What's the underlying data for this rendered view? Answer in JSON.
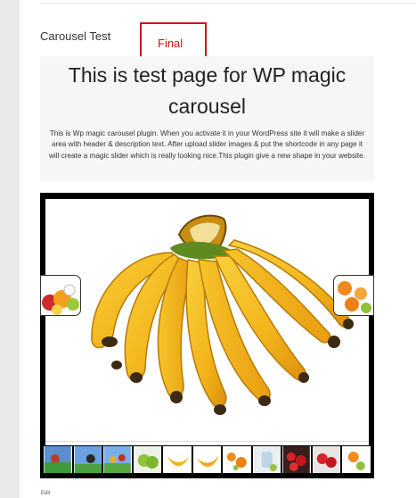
{
  "page": {
    "title": "Carousel Test",
    "annotation": "Final",
    "heading": "This is test page for WP magic carousel",
    "description": "This is Wp magic carousel plugin. When you activate it in your WordPress site it will make a slider area with header & description text. After upload slider images & put the shortcode in any page it will create a magic slider which is really looking nice.This plugin give a new shape in your website.",
    "edit_label": "Edit"
  },
  "slider": {
    "main_image": "banana-bunch",
    "prev_image": "fruit-pile",
    "next_image": "orange-slices",
    "thumbnails": [
      "cartoon-characters",
      "cartoon-characters",
      "cartoon-characters",
      "green-apples",
      "banana-bunch",
      "banana-bunch",
      "orange-slices",
      "glass-cup",
      "strawberries",
      "strawberries",
      "orange-slices"
    ]
  }
}
